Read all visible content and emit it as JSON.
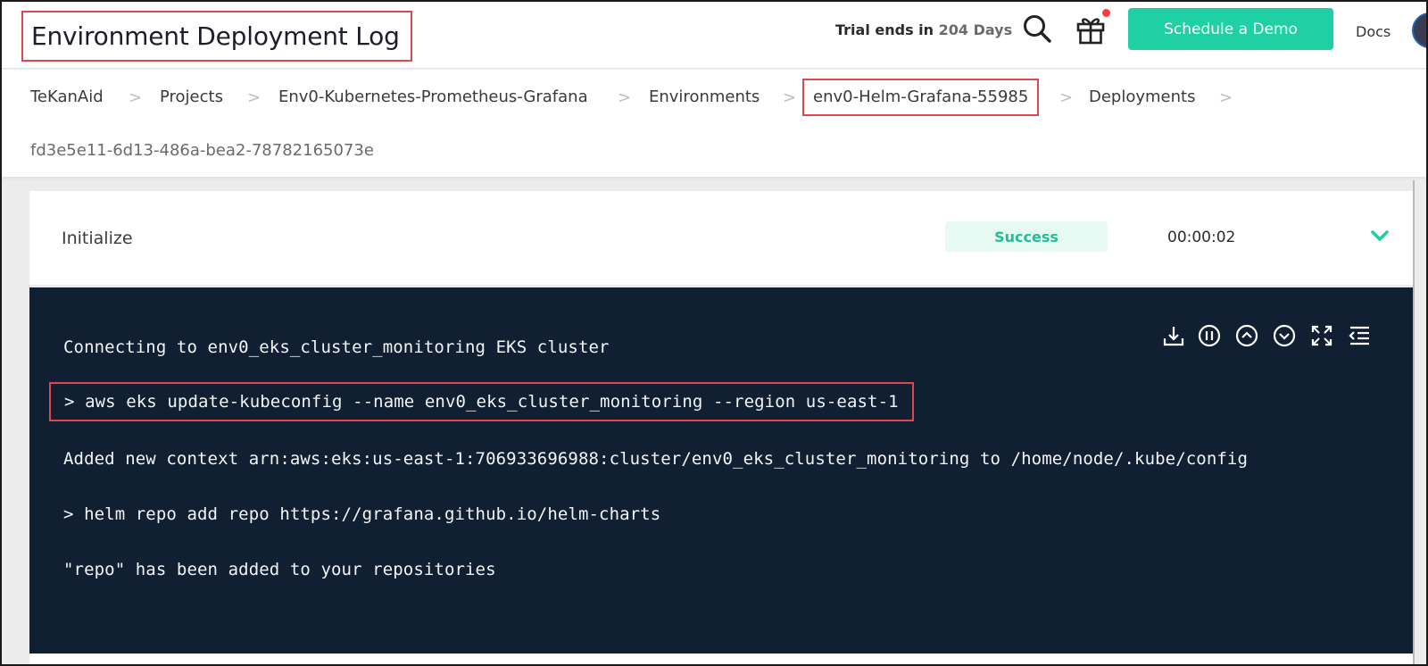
{
  "header": {
    "page_title": "Environment Deployment Log",
    "trial_prefix": "Trial ends in",
    "trial_days": "204 Days",
    "search_icon": "search-icon",
    "gift_icon": "gift-icon",
    "demo_button": "Schedule a Demo",
    "docs_link": "Docs"
  },
  "breadcrumb": {
    "items": [
      "TeKanAid",
      "Projects",
      "Env0-Kubernetes-Prometheus-Grafana",
      "Environments",
      "env0-Helm-Grafana-55985",
      "Deployments",
      "fd3e5e11-6d13-486a-bea2-78782165073e"
    ],
    "separator": ">"
  },
  "step": {
    "name": "Initialize",
    "status": "Success",
    "duration": "00:00:02"
  },
  "log": {
    "lines": [
      "Connecting to env0_eks_cluster_monitoring EKS cluster",
      "> aws eks update-kubeconfig --name env0_eks_cluster_monitoring --region us-east-1",
      "Added new context arn:aws:eks:us-east-1:706933696988:cluster/env0_eks_cluster_monitoring to /home/node/.kube/config",
      "> helm repo add repo https://grafana.github.io/helm-charts",
      "\"repo\" has been added to your repositories"
    ],
    "tools": [
      "download-icon",
      "pause-icon",
      "scroll-up-icon",
      "scroll-down-icon",
      "expand-icon",
      "wrap-lines-icon"
    ]
  },
  "colors": {
    "accent": "#1ed0a3",
    "highlight_border": "#e0474c",
    "log_background": "#102032",
    "success_text": "#1fbf95",
    "success_bg": "#e7f9f3"
  }
}
